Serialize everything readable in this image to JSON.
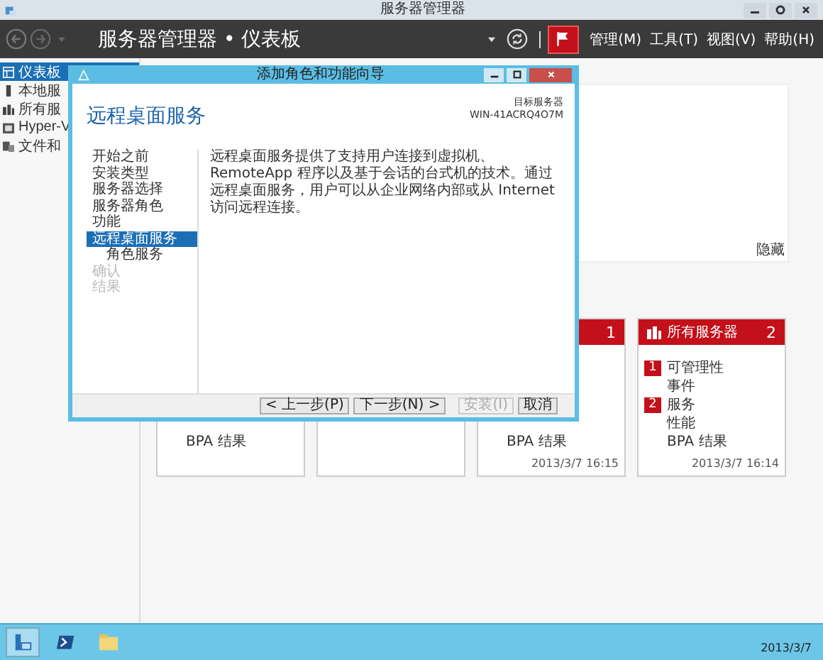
{
  "window": {
    "title": "服务器管理器"
  },
  "header": {
    "breadcrumb": "服务器管理器 • 仪表板",
    "menu": [
      "管理(M)",
      "工具(T)",
      "视图(V)",
      "帮助(H)"
    ]
  },
  "sidebar": {
    "items": [
      {
        "label": "仪表板",
        "selected": true
      },
      {
        "label": "本地服",
        "selected": false
      },
      {
        "label": "所有服",
        "selected": false
      },
      {
        "label": "Hyper-V",
        "selected": false
      },
      {
        "label": "文件和",
        "selected": false
      }
    ]
  },
  "top_panel": {
    "hide_link": "隐藏"
  },
  "tiles": [
    {
      "kind": "group",
      "rows": [
        {
          "label": "BPA 结果"
        }
      ]
    },
    {
      "kind": "empty"
    },
    {
      "kind": "group",
      "count": "1",
      "rows": [
        {
          "label": "BPA 结果"
        }
      ],
      "date": "2013/3/7 16:15"
    },
    {
      "kind": "group",
      "title": "所有服务器",
      "count": "2",
      "rows": [
        {
          "badge": "1",
          "label": "可管理性"
        },
        {
          "label": "事件"
        },
        {
          "badge": "2",
          "label": "服务"
        },
        {
          "label": "性能"
        },
        {
          "label": "BPA 结果"
        }
      ],
      "date": "2013/3/7 16:14"
    }
  ],
  "dialog": {
    "title": "添加角色和功能向导",
    "heading": "远程桌面服务",
    "target_label": "目标服务器",
    "target_server": "WIN-41ACRQ4O7M",
    "nav": [
      {
        "label": "开始之前",
        "selected": false,
        "disabled": false
      },
      {
        "label": "安装类型",
        "selected": false,
        "disabled": false
      },
      {
        "label": "服务器选择",
        "selected": false,
        "disabled": false
      },
      {
        "label": "服务器角色",
        "selected": false,
        "disabled": false
      },
      {
        "label": "功能",
        "selected": false,
        "disabled": false
      },
      {
        "label": "远程桌面服务",
        "selected": true,
        "disabled": false,
        "children": [
          {
            "label": "角色服务",
            "selected": false,
            "disabled": false
          }
        ]
      },
      {
        "label": "确认",
        "selected": false,
        "disabled": true
      },
      {
        "label": "结果",
        "selected": false,
        "disabled": true
      }
    ],
    "description": "远程桌面服务提供了支持用户连接到虚拟机、RemoteApp 程序以及基于会话的台式机的技术。通过远程桌面服务，用户可以从企业网络内部或从 Internet 访问远程连接。",
    "buttons": [
      {
        "label": "< 上一步(P)",
        "disabled": false
      },
      {
        "label": "下一步(N) >",
        "disabled": false
      },
      {
        "label": "安装(I)",
        "disabled": true
      },
      {
        "label": "取消",
        "disabled": false
      }
    ]
  },
  "taskbar": {
    "date": "2013/3/7"
  }
}
